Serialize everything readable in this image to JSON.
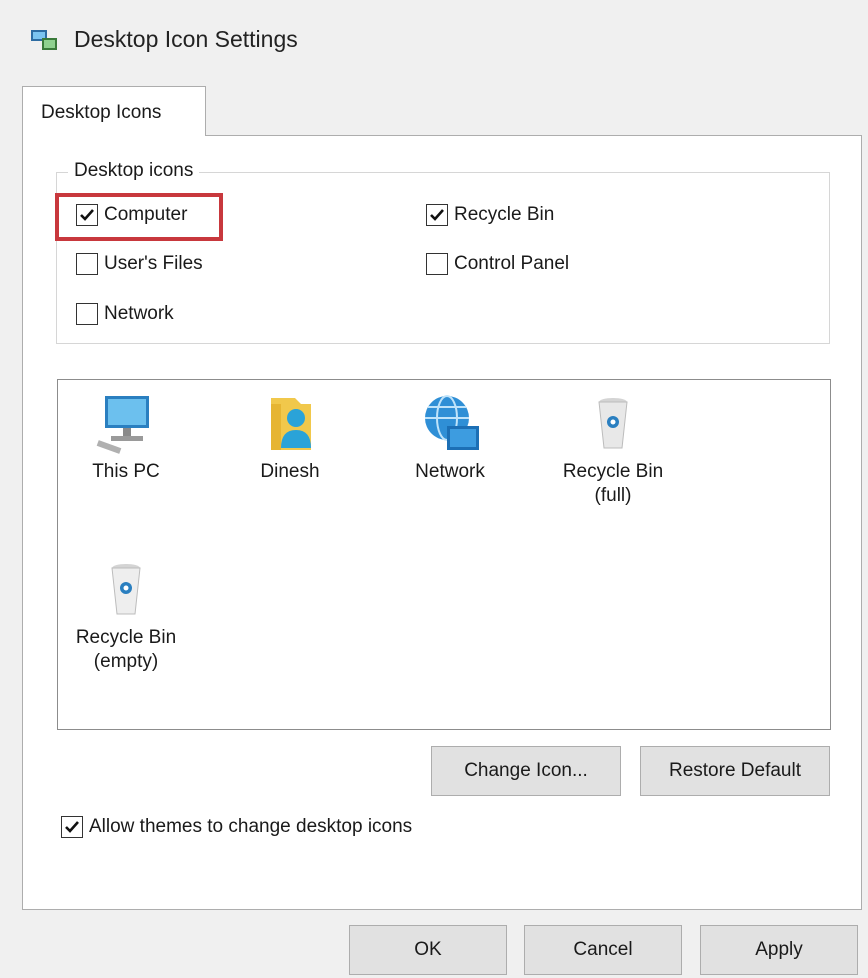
{
  "window": {
    "title": "Desktop Icon Settings"
  },
  "tabs": [
    {
      "label": "Desktop Icons"
    }
  ],
  "desktop_icons_group": {
    "legend": "Desktop icons",
    "checkboxes": [
      {
        "label": "Computer",
        "checked": true
      },
      {
        "label": "Recycle Bin",
        "checked": true
      },
      {
        "label": "User's Files",
        "checked": false
      },
      {
        "label": "Control Panel",
        "checked": false
      },
      {
        "label": "Network",
        "checked": false
      }
    ]
  },
  "icon_list": [
    {
      "label": "This PC",
      "icon": "monitor-icon"
    },
    {
      "label": "Dinesh",
      "icon": "user-folder-icon"
    },
    {
      "label": "Network",
      "icon": "network-globe-icon"
    },
    {
      "label": "Recycle Bin\n(full)",
      "icon": "recycle-bin-full-icon"
    },
    {
      "label": "Recycle Bin\n(empty)",
      "icon": "recycle-bin-empty-icon"
    }
  ],
  "buttons": {
    "change_icon": "Change Icon...",
    "restore_default": "Restore Default",
    "ok": "OK",
    "cancel": "Cancel",
    "apply": "Apply"
  },
  "allow_themes": {
    "label": "Allow themes to change desktop icons",
    "checked": true
  },
  "colors": {
    "highlight": "#c8383d",
    "accent": "#1e90d6"
  }
}
